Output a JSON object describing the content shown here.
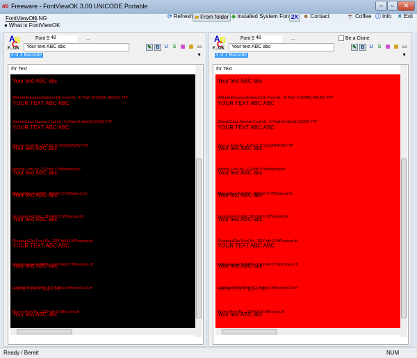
{
  "window": {
    "title": "Freeware - FontViewOK 3.00 UNICODE Portable"
  },
  "menu": {
    "items": [
      "FontViewOK",
      "LNG"
    ],
    "what_is": "What is FontViewOK"
  },
  "toolbar": {
    "refresh": "Refresh",
    "from_folder": "From folder",
    "installed": "Installed System Fonts",
    "twox": "2X",
    "contact": "Contact",
    "coffee": "Coffee",
    "info": "Info",
    "exit": "Exit"
  },
  "panels": [
    {
      "font_size_label": "Font Size :",
      "font_size": "48",
      "dots": "...",
      "text": "Your text ABC abc",
      "combo": "3 of 3 Barcode",
      "header": "Ihr Text",
      "bg": "#000000",
      "fg": "#ff0000"
    },
    {
      "font_size_label": "Font Size :",
      "font_size": "48",
      "dots": "...",
      "text": "Your text ABC abc",
      "combo": "3 of 3 Barcode",
      "header": "Ihr Text",
      "bg": "#ff0000",
      "fg": "#000000",
      "clone_label": "Be a Clone"
    }
  ],
  "format_buttons": [
    "✎",
    "B",
    "U",
    "S",
    "▦",
    "▦",
    "▭"
  ],
  "samples": [
    {
      "text": "Your text ABC abc",
      "caption": "WilhelmKlingsporGotisch-Dfr Font-Nr.: 4] Path:D:\\ttf\\WILHELM1.TTF"
    },
    {
      "text": "YOUR TEXT ABC ABC",
      "caption": "ZaleskiCaps-Normal Font-Nr.: 5] Path:D:\\ttf\\ZALESKIE.TTF"
    },
    {
      "text": "YOUR TEXT ABC ABC",
      "caption": "Zarrow Font-Nr.: 6] Path:D:\\ttf\\ZARROW.TTF"
    },
    {
      "text": "Your text ABC abc",
      "caption": "Batang Font-Nr.: 7] Path:D:\\ttf\\batang.ttc"
    },
    {
      "text": "Your text ABC abc",
      "caption": "BatangChe Font-Nr.: 8] Path:D:\\ttf\\batang.ttc"
    },
    {
      "text": "Your text ABC abc",
      "caption": "Gungsuh Font-Nr.: 9] Path:D:\\ttf\\batang.ttc"
    },
    {
      "text": "Your text ABC abc",
      "caption": "GungsuhChe Font-Nr.: 10] Path:D:\\ttf\\batang.ttc"
    },
    {
      "text": "YOUR TEXT ABC ABC",
      "caption": "IndianaJones Font-Nr.: 11] Path:D:\\ttf\\indiana.ttf"
    },
    {
      "text": "Your text ABC abc",
      "caption": "Halloween Font-Nr.: 12] Path:D:\\ttf\\komik013.ttf"
    },
    {
      "text": "ᛃᛟᚢᚱ ᛏᛖᚦᛏ ᛒᛞᚲ ᚨᛒᚲ",
      "caption": "Runen Font-Nr.: 13] Path:D:\\ttf\\runen.ttf"
    },
    {
      "text": "Your text ABC abc",
      "caption": "Spiegel Arial Font-Nr.: 14] Path:D:\\ttf\\spiegel.ttf"
    }
  ],
  "status": {
    "text": "Ready / Bereit",
    "num": "NUM"
  }
}
